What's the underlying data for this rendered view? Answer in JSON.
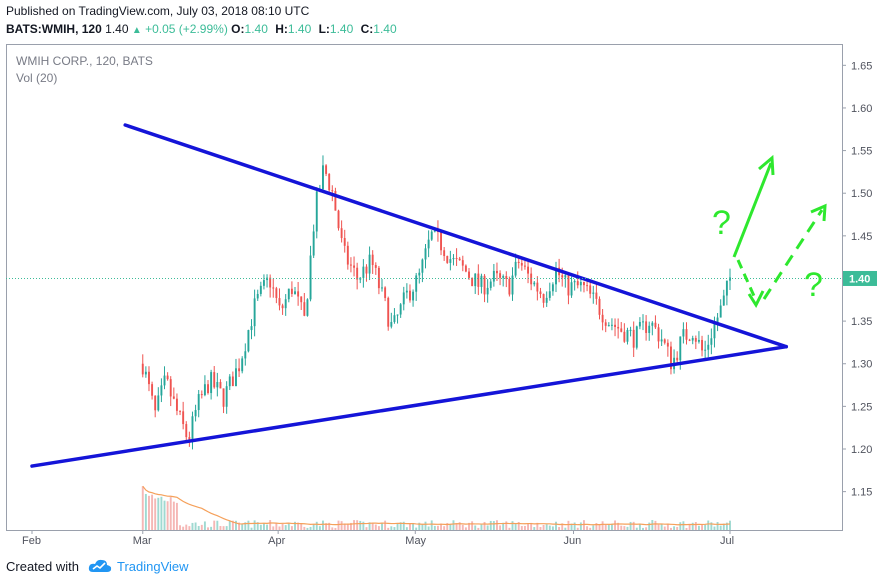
{
  "header": {
    "published": "Published on TradingView.com, July 03, 2018 08:10 UTC",
    "symbol": "BATS:WMIH, 120",
    "last": "1.40",
    "change": "+0.05 (+2.99%)",
    "o_label": "O:",
    "o_val": "1.40",
    "h_label": "H:",
    "h_val": "1.40",
    "l_label": "L:",
    "l_val": "1.40",
    "c_label": "C:",
    "c_val": "1.40"
  },
  "legend": {
    "title": "WMIH CORP., 120, BATS",
    "vol": "Vol (20)"
  },
  "footer": {
    "created_with": "Created with",
    "brand": "TradingView"
  },
  "colors": {
    "up": "#26a69a",
    "down": "#ef5350",
    "trendline": "#1414d8",
    "annotation": "#2ee82e",
    "last_price_badge": "#3cbc98",
    "volume_ma": "#f5a05a"
  },
  "chart_data": {
    "type": "candlestick",
    "x_axis": {
      "ticks": [
        "Feb",
        "Mar",
        "Apr",
        "May",
        "Jun",
        "Jul"
      ]
    },
    "y_axis": {
      "ticks": [
        1.15,
        1.2,
        1.25,
        1.3,
        1.35,
        1.4,
        1.45,
        1.5,
        1.55,
        1.6,
        1.65
      ],
      "range": [
        1.105,
        1.675
      ],
      "position": "right"
    },
    "last_price": 1.4,
    "last_price_label": "1.40",
    "price_path": [
      {
        "t": 0.0,
        "p": 1.3
      },
      {
        "t": 0.7,
        "p": 1.24
      },
      {
        "t": 1.3,
        "p": 1.28
      },
      {
        "t": 2.0,
        "p": 1.24
      },
      {
        "t": 2.6,
        "p": 1.21
      },
      {
        "t": 3.1,
        "p": 1.25
      },
      {
        "t": 3.8,
        "p": 1.28
      },
      {
        "t": 4.6,
        "p": 1.26
      },
      {
        "t": 5.5,
        "p": 1.3
      },
      {
        "t": 6.4,
        "p": 1.37
      },
      {
        "t": 7.2,
        "p": 1.4
      },
      {
        "t": 7.8,
        "p": 1.36
      },
      {
        "t": 8.5,
        "p": 1.39
      },
      {
        "t": 9.2,
        "p": 1.35
      },
      {
        "t": 9.8,
        "p": 1.48
      },
      {
        "t": 10.3,
        "p": 1.53
      },
      {
        "t": 10.8,
        "p": 1.5
      },
      {
        "t": 11.4,
        "p": 1.43
      },
      {
        "t": 12.2,
        "p": 1.4
      },
      {
        "t": 13.0,
        "p": 1.42
      },
      {
        "t": 13.6,
        "p": 1.38
      },
      {
        "t": 14.2,
        "p": 1.34
      },
      {
        "t": 15.0,
        "p": 1.38
      },
      {
        "t": 15.7,
        "p": 1.4
      },
      {
        "t": 16.4,
        "p": 1.45
      },
      {
        "t": 17.0,
        "p": 1.44
      },
      {
        "t": 17.6,
        "p": 1.42
      },
      {
        "t": 18.3,
        "p": 1.41
      },
      {
        "t": 19.2,
        "p": 1.39
      },
      {
        "t": 20.0,
        "p": 1.4
      },
      {
        "t": 20.8,
        "p": 1.39
      },
      {
        "t": 21.4,
        "p": 1.42
      },
      {
        "t": 22.0,
        "p": 1.4
      },
      {
        "t": 22.8,
        "p": 1.38
      },
      {
        "t": 23.5,
        "p": 1.41
      },
      {
        "t": 24.1,
        "p": 1.39
      },
      {
        "t": 25.0,
        "p": 1.39
      },
      {
        "t": 25.8,
        "p": 1.37
      },
      {
        "t": 26.5,
        "p": 1.35
      },
      {
        "t": 27.2,
        "p": 1.34
      },
      {
        "t": 28.0,
        "p": 1.33
      },
      {
        "t": 28.8,
        "p": 1.35
      },
      {
        "t": 29.5,
        "p": 1.33
      },
      {
        "t": 30.1,
        "p": 1.3
      },
      {
        "t": 30.7,
        "p": 1.33
      },
      {
        "t": 31.3,
        "p": 1.34
      },
      {
        "t": 31.9,
        "p": 1.31
      },
      {
        "t": 32.4,
        "p": 1.34
      },
      {
        "t": 33.0,
        "p": 1.37
      },
      {
        "t": 33.4,
        "p": 1.4
      }
    ],
    "trendlines": [
      {
        "name": "upper-trendline",
        "from": {
          "t": -1.0,
          "p": 1.58
        },
        "to": {
          "t": 36.6,
          "p": 1.32
        }
      },
      {
        "name": "lower-trendline",
        "from": {
          "t": -6.3,
          "p": 1.18
        },
        "to": {
          "t": 36.6,
          "p": 1.32
        }
      }
    ]
  }
}
